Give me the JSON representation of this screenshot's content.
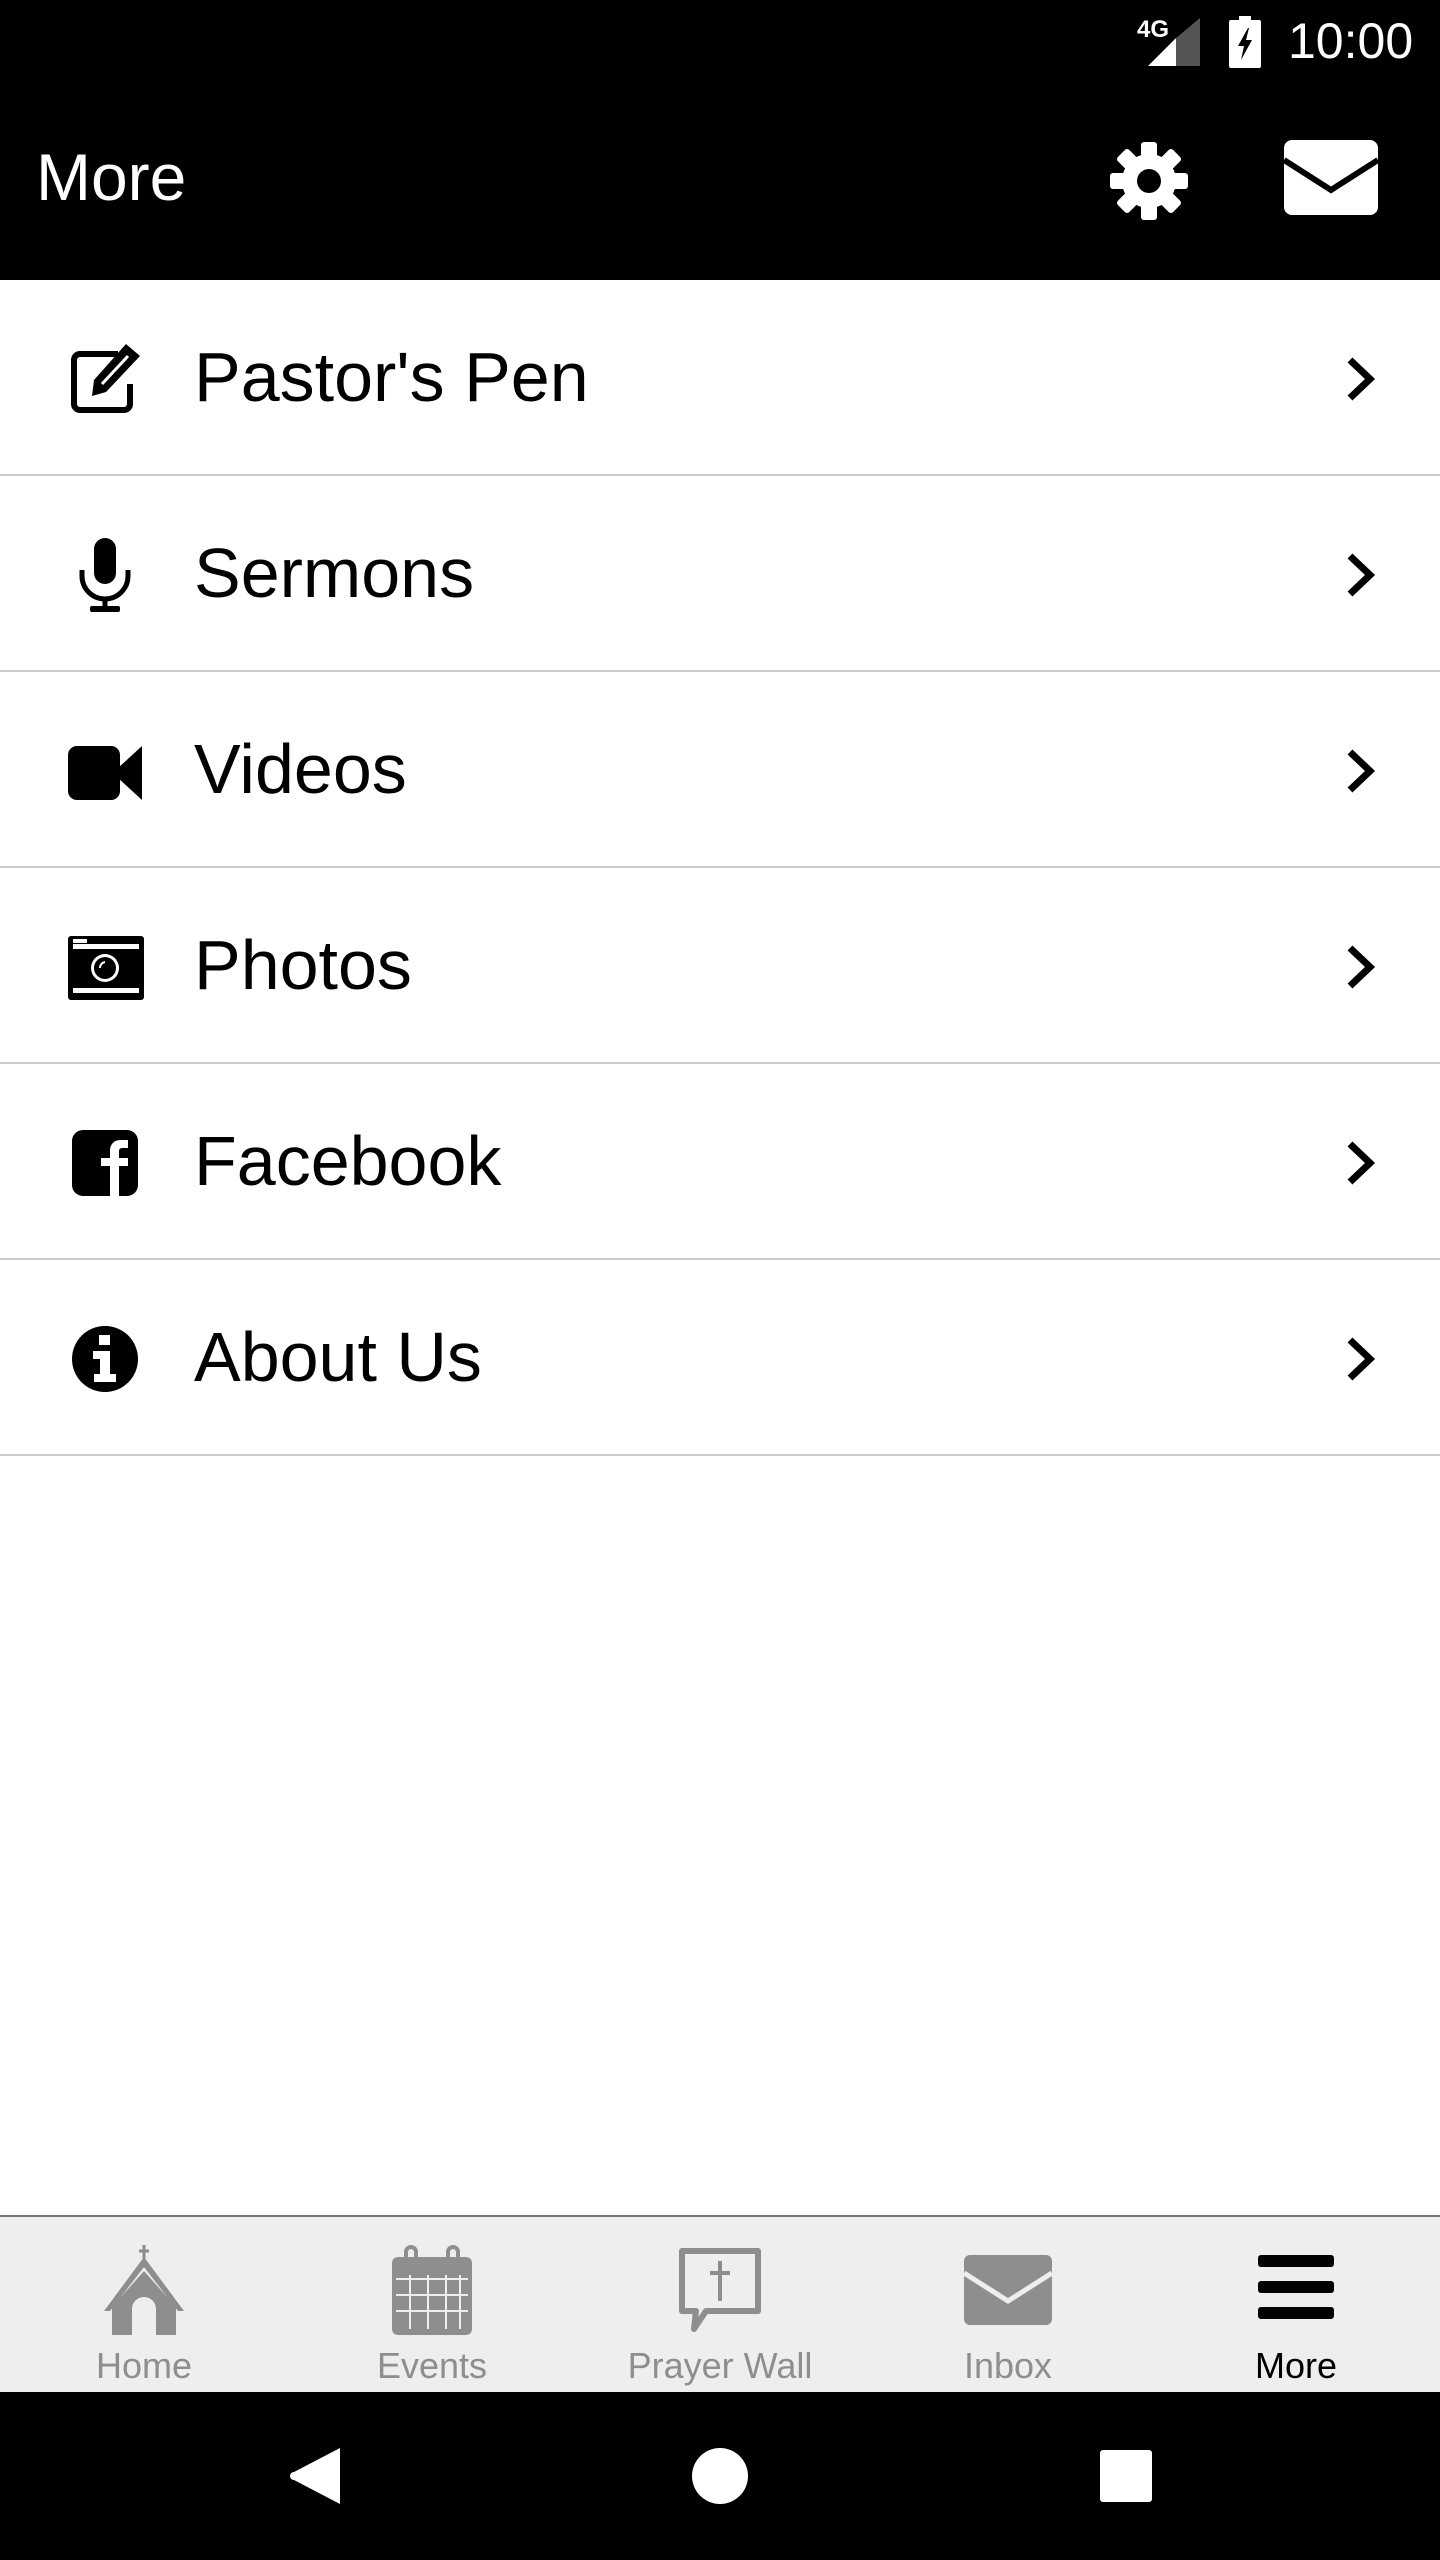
{
  "status_bar": {
    "network": "4G",
    "time": "10:00",
    "icons": [
      "signal-icon",
      "battery-charging-icon"
    ]
  },
  "app_bar": {
    "title": "More",
    "actions": [
      {
        "name": "settings",
        "icon": "gear-icon"
      },
      {
        "name": "messages",
        "icon": "mail-icon"
      }
    ]
  },
  "menu": {
    "items": [
      {
        "label": "Pastor's Pen",
        "icon": "edit-icon"
      },
      {
        "label": "Sermons",
        "icon": "microphone-icon"
      },
      {
        "label": "Videos",
        "icon": "video-camera-icon"
      },
      {
        "label": "Photos",
        "icon": "camera-icon"
      },
      {
        "label": "Facebook",
        "icon": "facebook-icon"
      },
      {
        "label": "About Us",
        "icon": "info-icon"
      }
    ]
  },
  "tab_bar": {
    "tabs": [
      {
        "label": "Home",
        "icon": "church-icon",
        "active": false
      },
      {
        "label": "Events",
        "icon": "calendar-icon",
        "active": false
      },
      {
        "label": "Prayer Wall",
        "icon": "prayer-bubble-icon",
        "active": false
      },
      {
        "label": "Inbox",
        "icon": "mail-icon",
        "active": false
      },
      {
        "label": "More",
        "icon": "menu-icon",
        "active": true
      }
    ],
    "colors": {
      "inactive": "#8e8e8e",
      "active": "#000000",
      "background": "#eeeeee"
    }
  },
  "nav_bar": {
    "buttons": [
      "back",
      "home",
      "recents"
    ]
  }
}
